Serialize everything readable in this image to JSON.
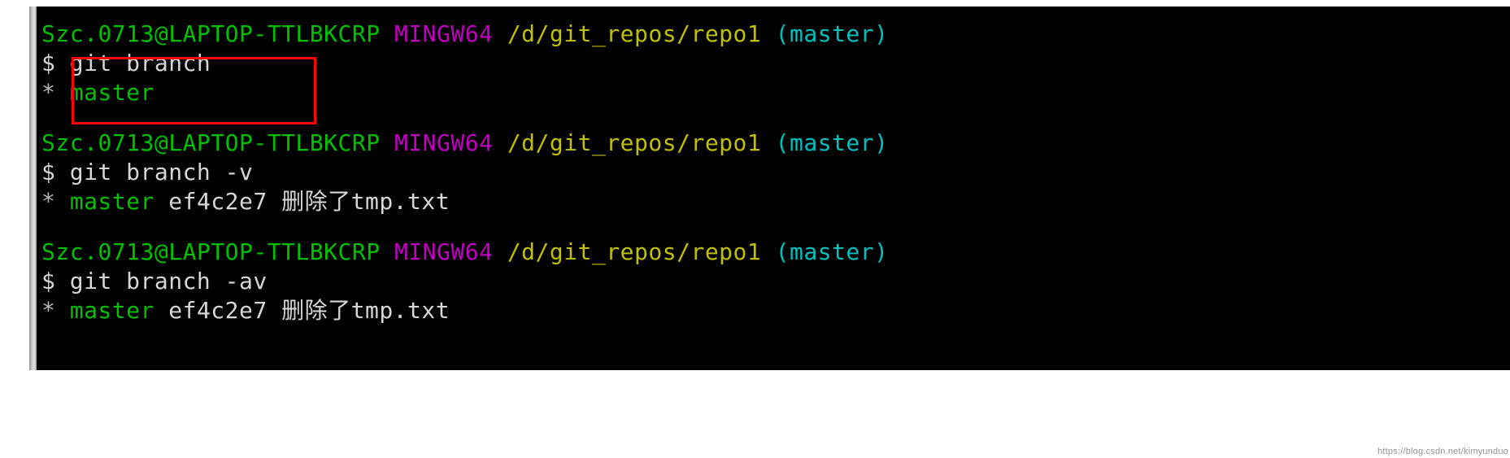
{
  "window": {
    "shell": "MINGW64",
    "background_color": "#000000",
    "page_background_color": "#ffffff"
  },
  "palette": {
    "prompt_user_host": "#00c000",
    "shell_name": "#c000c0",
    "path": "#c0c000",
    "branch_paren": "#00c0c0",
    "command_text": "#d6d6d6",
    "annotation_box": "#ff0000"
  },
  "prompt": {
    "user_host": "Szc.0713@LAPTOP-TTLBKCRP",
    "shell": "MINGW64",
    "path": "/d/git_repos/repo1",
    "branch": "(master)"
  },
  "blocks": [
    {
      "id": "block-1",
      "prompt": {
        "user_host": "Szc.0713@LAPTOP-TTLBKCRP",
        "shell": "MINGW64",
        "path": "/d/git_repos/repo1",
        "branch": "(master)"
      },
      "command_sigil": "$",
      "command": "git branch",
      "output": [
        {
          "marker": "*",
          "branch": "master",
          "commit": "",
          "message": ""
        }
      ]
    },
    {
      "id": "block-2",
      "prompt": {
        "user_host": "Szc.0713@LAPTOP-TTLBKCRP",
        "shell": "MINGW64",
        "path": "/d/git_repos/repo1",
        "branch": "(master)"
      },
      "command_sigil": "$",
      "command": "git branch -v",
      "output": [
        {
          "marker": "*",
          "branch": "master",
          "commit": "ef4c2e7",
          "message": "删除了tmp.txt"
        }
      ]
    },
    {
      "id": "block-3",
      "prompt": {
        "user_host": "Szc.0713@LAPTOP-TTLBKCRP",
        "shell": "MINGW64",
        "path": "/d/git_repos/repo1",
        "branch": "(master)"
      },
      "command_sigil": "$",
      "command": "git branch -av",
      "output": [
        {
          "marker": "*",
          "branch": "master",
          "commit": "ef4c2e7",
          "message": "删除了tmp.txt"
        }
      ]
    }
  ],
  "annotation": {
    "shape": "rectangle",
    "color": "#ff0000",
    "encloses": "$ git branch\n* master"
  },
  "watermark": {
    "text": "https://blog.csdn.net/kimyunduo"
  }
}
